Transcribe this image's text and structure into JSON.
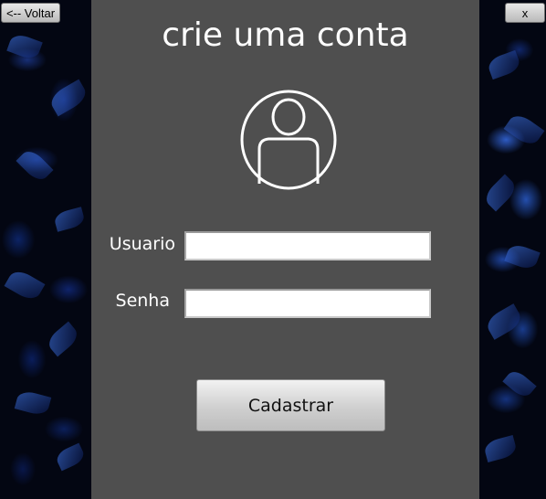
{
  "window": {
    "back_label": "<-- Voltar",
    "close_label": "x"
  },
  "form": {
    "title": "crie uma conta",
    "avatar_icon": "user-circle-icon",
    "username_label": "Usuario",
    "username_value": "",
    "password_label": "Senha",
    "password_value": "",
    "submit_label": "Cadastrar"
  },
  "colors": {
    "panel": "#4f4f4f",
    "text": "#ffffff",
    "background_accent": "#2f63e0"
  }
}
